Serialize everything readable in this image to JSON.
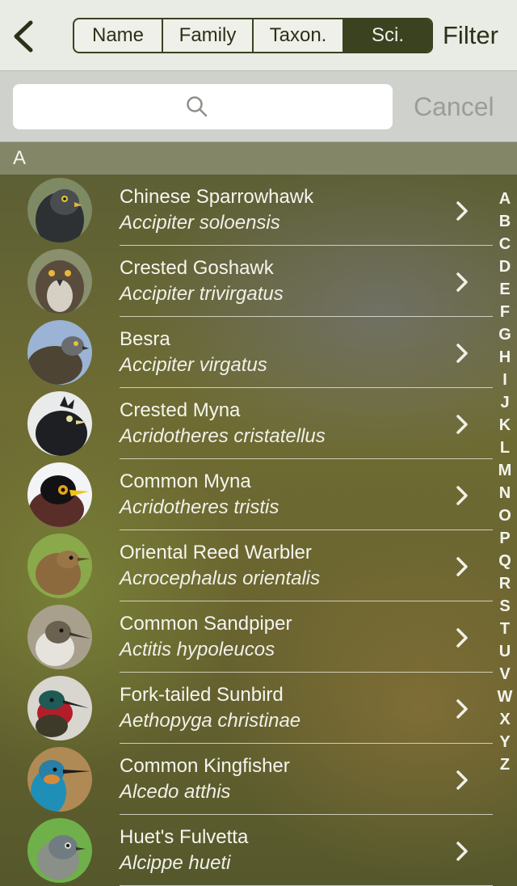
{
  "header": {
    "segments": [
      "Name",
      "Family",
      "Taxon.",
      "Sci."
    ],
    "selected_segment": "Sci.",
    "filter_label": "Filter"
  },
  "search": {
    "placeholder": "",
    "cancel_label": "Cancel"
  },
  "section_header": "A",
  "birds": [
    {
      "name": "Chinese Sparrowhawk",
      "scientific": "Accipiter soloensis"
    },
    {
      "name": "Crested Goshawk",
      "scientific": "Accipiter trivirgatus"
    },
    {
      "name": "Besra",
      "scientific": "Accipiter virgatus"
    },
    {
      "name": "Crested Myna",
      "scientific": "Acridotheres cristatellus"
    },
    {
      "name": "Common Myna",
      "scientific": "Acridotheres tristis"
    },
    {
      "name": "Oriental Reed Warbler",
      "scientific": "Acrocephalus orientalis"
    },
    {
      "name": "Common Sandpiper",
      "scientific": "Actitis hypoleucos"
    },
    {
      "name": "Fork-tailed Sunbird",
      "scientific": "Aethopyga christinae"
    },
    {
      "name": "Common Kingfisher",
      "scientific": "Alcedo atthis"
    },
    {
      "name": "Huet's Fulvetta",
      "scientific": "Alcippe hueti"
    }
  ],
  "index_letters": [
    "A",
    "B",
    "C",
    "D",
    "E",
    "F",
    "G",
    "H",
    "I",
    "J",
    "K",
    "L",
    "M",
    "N",
    "O",
    "P",
    "Q",
    "R",
    "S",
    "T",
    "U",
    "V",
    "W",
    "X",
    "Y",
    "Z"
  ],
  "colors": {
    "accent": "#3a4220",
    "nav_background": "#e9ebe5",
    "list_text": "#f5f5ef",
    "cancel_text": "#9b9e98"
  },
  "icons": {
    "back": "chevron-left-icon",
    "search": "search-icon",
    "row_disclosure": "chevron-right-icon"
  }
}
